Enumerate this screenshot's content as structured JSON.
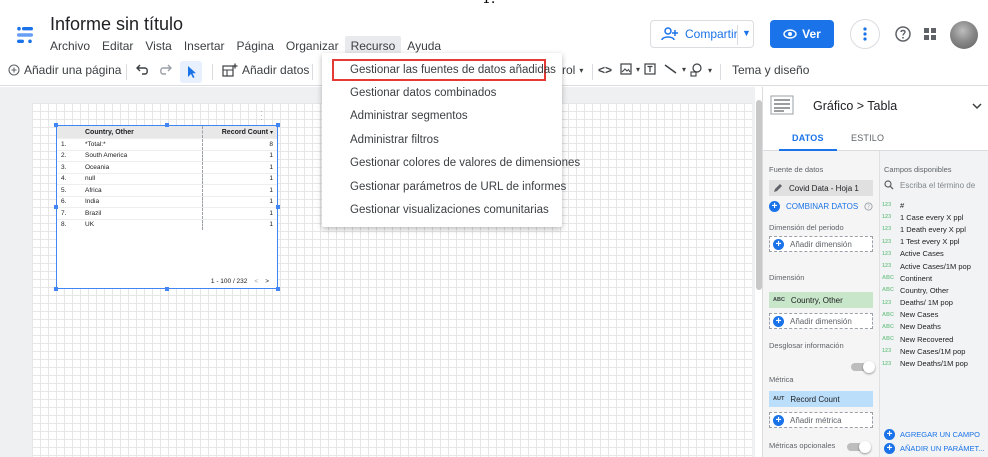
{
  "caption_fragment": "1.",
  "app": {
    "title": "Informe sin título"
  },
  "menubar": {
    "items": [
      "Archivo",
      "Editar",
      "Vista",
      "Insertar",
      "Página",
      "Organizar",
      "Recurso",
      "Ayuda"
    ],
    "active": "Recurso"
  },
  "header": {
    "share_label": "Compartir",
    "view_label": "Ver"
  },
  "toolbar": {
    "add_page": "Añadir una página",
    "add_data": "Añadir datos",
    "control_fragment": "rol",
    "theme_layout": "Tema y diseño"
  },
  "resource_menu": {
    "items": [
      "Gestionar las fuentes de datos añadidas",
      "Gestionar datos combinados",
      "Administrar segmentos",
      "Administrar filtros",
      "Gestionar colores de valores de dimensiones",
      "Gestionar parámetros de URL de informes",
      "Gestionar visualizaciones comunitarias"
    ],
    "highlighted_index": 0,
    "highlight_color": "#e53935"
  },
  "table": {
    "headers": {
      "dimension": "Country, Other",
      "metric": "Record Count"
    },
    "rows": [
      {
        "idx": "1.",
        "name": "*Total:*",
        "value": "8"
      },
      {
        "idx": "2.",
        "name": "South America",
        "value": "1"
      },
      {
        "idx": "3.",
        "name": "Oceania",
        "value": "1"
      },
      {
        "idx": "4.",
        "name": "null",
        "value": "1"
      },
      {
        "idx": "5.",
        "name": "Africa",
        "value": "1"
      },
      {
        "idx": "6.",
        "name": "India",
        "value": "1"
      },
      {
        "idx": "7.",
        "name": "Brazil",
        "value": "1"
      },
      {
        "idx": "8.",
        "name": "UK",
        "value": "1"
      }
    ],
    "pagination": "1 - 100 / 232"
  },
  "panel": {
    "chart_title": "Gráfico > Tabla",
    "tabs": [
      "DATOS",
      "ESTILO"
    ],
    "data_source_label": "Fuente de datos",
    "data_source": "Covid Data - Hoja 1",
    "blend_label": "COMBINAR DATOS",
    "period_dimension_label": "Dimensión del periodo",
    "add_dimension": "Añadir dimensión",
    "dimension_label": "Dimensión",
    "dimension_value": "Country, Other",
    "breakdown_label": "Desglosar información",
    "metric_label": "Métrica",
    "metric_value": "Record Count",
    "add_metric": "Añadir métrica",
    "optional_metrics_label": "Métricas opcionales",
    "available_fields_label": "Campos disponibles",
    "search_placeholder": "Escriba el término de",
    "fields": [
      {
        "type": "123",
        "name": "#"
      },
      {
        "type": "123",
        "name": "1 Case every X ppl"
      },
      {
        "type": "123",
        "name": "1 Death every X ppl"
      },
      {
        "type": "123",
        "name": "1 Test every X ppl"
      },
      {
        "type": "123",
        "name": "Active Cases"
      },
      {
        "type": "123",
        "name": "Active Cases/1M pop"
      },
      {
        "type": "ABC",
        "name": "Continent"
      },
      {
        "type": "ABC",
        "name": "Country, Other"
      },
      {
        "type": "123",
        "name": "Deaths/ 1M pop"
      },
      {
        "type": "ABC",
        "name": "New Cases"
      },
      {
        "type": "ABC",
        "name": "New Deaths"
      },
      {
        "type": "ABC",
        "name": "New Recovered"
      },
      {
        "type": "123",
        "name": "New Cases/1M pop"
      },
      {
        "type": "123",
        "name": "New Deaths/1M pop"
      }
    ],
    "add_field": "AGREGAR UN CAMPO",
    "add_param": "AÑADIR UN PARÁMET...",
    "tag_abc": "ABC",
    "tag_aut": "AUT"
  },
  "colors": {
    "accent": "#1a73e8",
    "dimension_chip": "#c8e6c9",
    "metric_chip": "#bbdefb"
  }
}
